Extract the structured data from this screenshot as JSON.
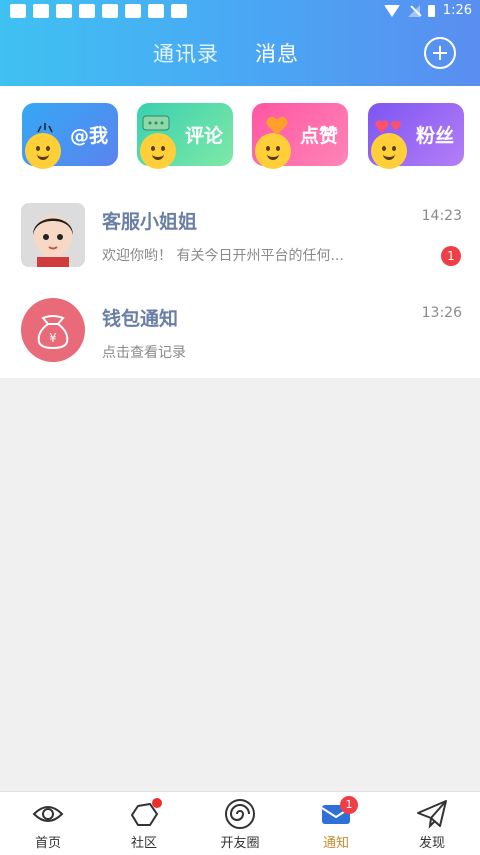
{
  "status_bar": {
    "time": "1:26",
    "icons": [
      "wifi-icon",
      "signal-icon",
      "battery-icon"
    ]
  },
  "header": {
    "tabs": [
      {
        "label": "通讯录",
        "active": false
      },
      {
        "label": "消息",
        "active": true
      }
    ],
    "add_icon": "plus-circle-icon"
  },
  "cards": [
    {
      "label": "@我",
      "icon": "smiley-at-icon"
    },
    {
      "label": "评论",
      "icon": "smiley-comment-icon"
    },
    {
      "label": "点赞",
      "icon": "smiley-like-icon"
    },
    {
      "label": "粉丝",
      "icon": "smiley-fans-icon"
    }
  ],
  "messages": [
    {
      "title": "客服小姐姐",
      "subtitle": "欢迎你哟！ 有关今日开州平台的任何...",
      "time": "14:23",
      "badge": "1",
      "avatar": "girl-avatar"
    },
    {
      "title": "钱包通知",
      "subtitle": "点击查看记录",
      "time": "13:26",
      "badge": "",
      "avatar": "wallet-icon"
    }
  ],
  "nav": [
    {
      "label": "首页",
      "icon": "eye-icon",
      "active": false
    },
    {
      "label": "社区",
      "icon": "hexagon-icon",
      "active": false,
      "dot": true
    },
    {
      "label": "开友圈",
      "icon": "spiral-icon",
      "active": false
    },
    {
      "label": "通知",
      "icon": "mail-icon",
      "active": true,
      "badge": "1"
    },
    {
      "label": "发现",
      "icon": "paper-plane-icon",
      "active": false
    }
  ],
  "colors": {
    "header_start": "#3fc1f2",
    "header_end": "#5a8ef0",
    "badge": "#ef3e45",
    "active_nav": "#c98a2e",
    "title_text": "#6a7fa6"
  }
}
